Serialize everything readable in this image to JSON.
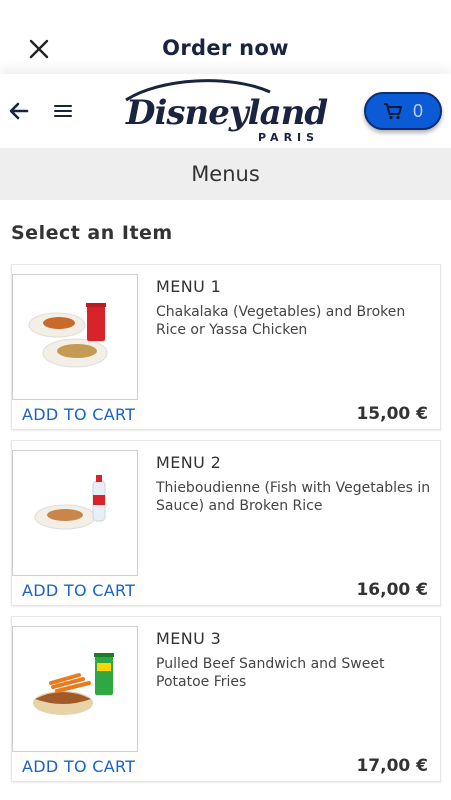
{
  "header": {
    "title": "Order now",
    "close_icon": "close-icon"
  },
  "brandbar": {
    "back_icon": "arrow-left-icon",
    "menu_icon": "hamburger-icon",
    "logo_text": "Disneyland",
    "logo_subtext": "PARIS",
    "cart_icon": "cart-icon",
    "cart_count": "0",
    "cart_color": "#0b5bd6"
  },
  "section": {
    "title": "Menus"
  },
  "list": {
    "heading": "Select an Item",
    "items": [
      {
        "name": "MENU 1",
        "description": "Chakalaka (Vegetables) and Broken Rice or Yassa Chicken",
        "action": "ADD TO CART",
        "price": "15,00 €"
      },
      {
        "name": "MENU 2",
        "description": "Thieboudienne (Fish with Vegetables in Sauce) and Broken Rice",
        "action": "ADD TO CART",
        "price": "16,00 €"
      },
      {
        "name": "MENU 3",
        "description": "Pulled Beef Sandwich and Sweet Potatoe Fries",
        "action": "ADD TO CART",
        "price": "17,00 €"
      }
    ]
  },
  "colors": {
    "accent_link": "#1565c8",
    "title": "#1a2340"
  }
}
